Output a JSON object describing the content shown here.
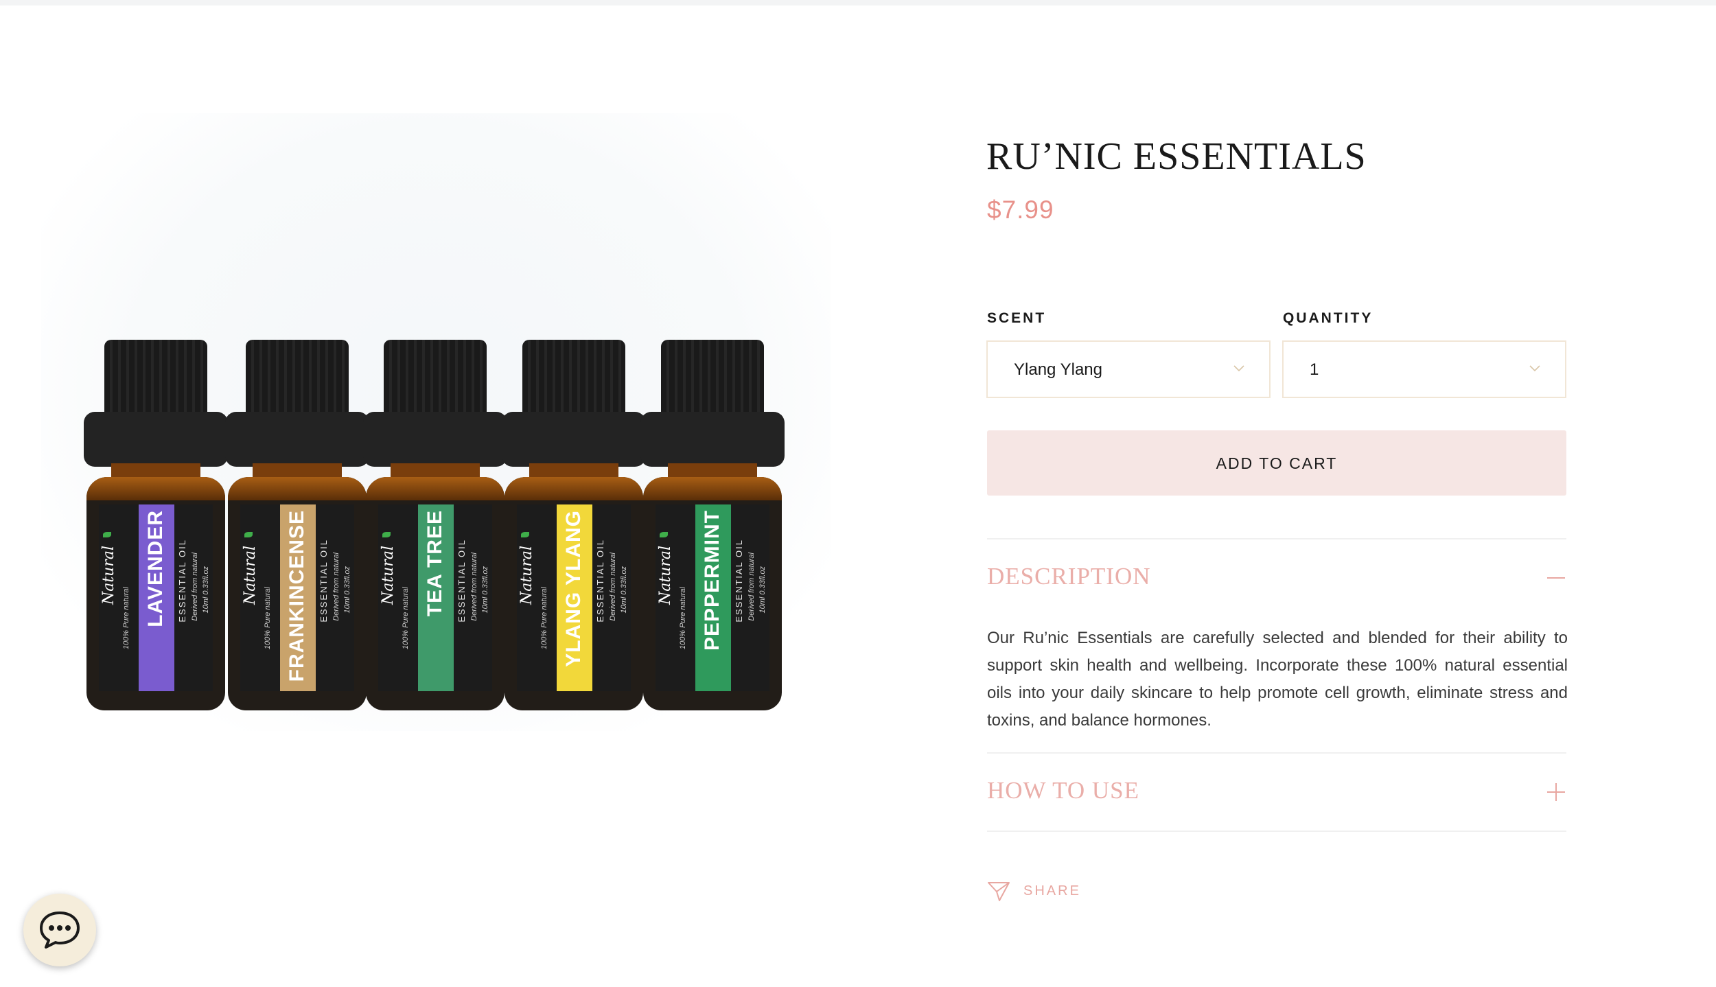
{
  "product": {
    "title": "RU’NIC ESSENTIALS",
    "price": "$7.99"
  },
  "image": {
    "bottles": [
      {
        "name": "LAVENDER",
        "sub": "ESSENTIAL OIL",
        "band_color": "#7a5ccf",
        "text_color": "#ffffff"
      },
      {
        "name": "FRANKINCENSE",
        "sub": "ESSENTIAL OIL",
        "band_color": "#c9a36b",
        "text_color": "#ffffff"
      },
      {
        "name": "TEA TREE",
        "sub": "ESSENTIAL OIL",
        "band_color": "#3f9a6a",
        "text_color": "#ffffff"
      },
      {
        "name": "YLANG YLANG",
        "sub": "ESSENTIAL OIL",
        "band_color": "#f2d83a",
        "text_color": "#ffffff"
      },
      {
        "name": "PEPPERMINT",
        "sub": "ESSENTIAL OIL",
        "band_color": "#2f9a5c",
        "text_color": "#ffffff"
      }
    ],
    "brand_script": "Natural",
    "tagline": "100% Pure natural",
    "note": "Derived from natural",
    "volume": "10ml 0.33fl.oz"
  },
  "scent": {
    "label": "SCENT",
    "value": "Ylang Ylang"
  },
  "quantity": {
    "label": "QUANTITY",
    "value": "1"
  },
  "cart": {
    "label": "ADD TO CART"
  },
  "description": {
    "title": "DESCRIPTION",
    "text": "Our Ru’nic Essentials are carefully selected and blended for their ability to support skin health and wellbeing. Incorporate these 100% natural essential oils into your daily skincare to help promote cell growth, eliminate stress and toxins, and balance hormones."
  },
  "how_to_use": {
    "title": "HOW TO USE"
  },
  "share": {
    "label": "SHARE"
  },
  "colors": {
    "accent": "#e8918a",
    "button_bg": "#f6e6e4",
    "select_border": "#f1e6d6",
    "chat_bg": "#f5eddb"
  }
}
